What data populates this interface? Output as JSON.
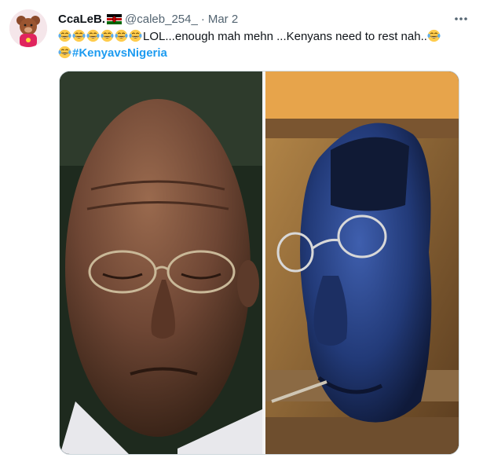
{
  "tweet": {
    "display_name": "CcaLeB.",
    "handle": "@caleb_254_",
    "separator": "·",
    "date": "Mar 2",
    "text_body": "LOL...enough mah mehn ...Kenyans need to rest nah..",
    "hashtag": "#KenyavsNigeria",
    "emoji_count_leading": 6,
    "icons": [
      "avatar",
      "kenya-flag-icon",
      "more-icon",
      "laughing-emoji-icon"
    ],
    "colors": {
      "hashtag": "#1d9bf0",
      "secondary_text": "#536471"
    }
  }
}
